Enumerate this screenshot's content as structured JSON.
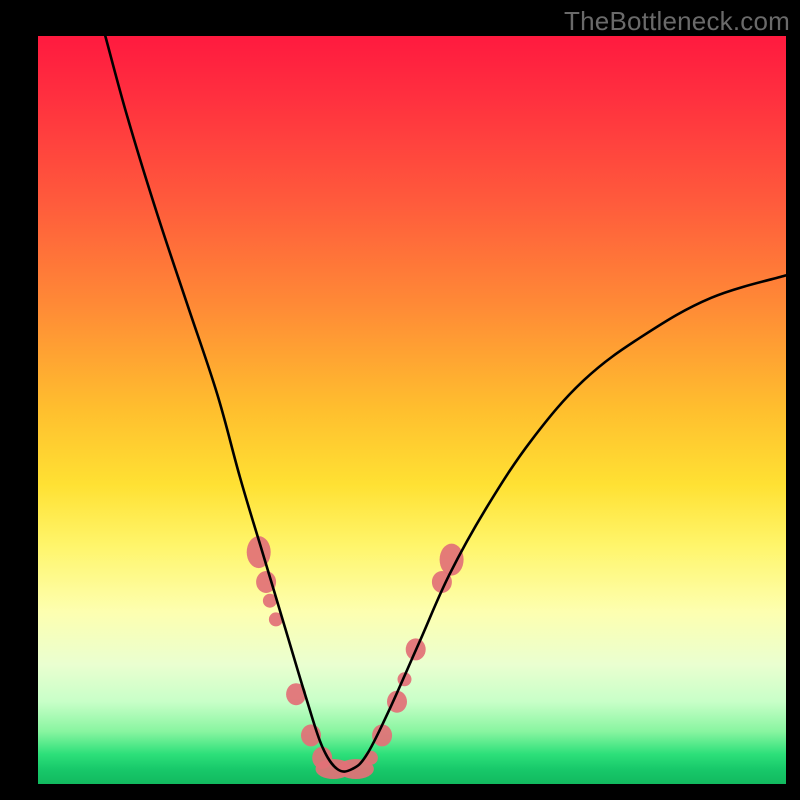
{
  "watermark": "TheBottleneck.com",
  "colors": {
    "gradient_top": "#ff1a3f",
    "gradient_mid": "#ffe133",
    "gradient_bottom": "#12b95f",
    "curve": "#000000",
    "cluster": "#e27177",
    "frame": "#000000"
  },
  "chart_data": {
    "type": "line",
    "title": "",
    "xlabel": "",
    "ylabel": "",
    "xlim": [
      0,
      100
    ],
    "ylim": [
      0,
      100
    ],
    "note": "No axes, ticks, or numeric labels are rendered. X/Y values are read as percentage positions within the gradient plot area. Y measures height above the bottom edge; 0 = bottom (green), 100 = top (red). The curve is a V-shape with a flat minimum around x≈37–44.",
    "optimum_x_range": [
      37,
      44
    ],
    "series": [
      {
        "name": "bottleneck-curve",
        "x": [
          9,
          12,
          16,
          20,
          24,
          27,
          30,
          33,
          36,
          38,
          40,
          42,
          44,
          47,
          51,
          55,
          60,
          66,
          73,
          81,
          90,
          100
        ],
        "y": [
          100,
          89,
          76,
          64,
          52,
          41,
          31,
          21,
          11,
          5,
          2,
          2,
          4,
          10,
          19,
          28,
          37,
          46,
          54,
          60,
          65,
          68
        ]
      }
    ],
    "clusters": {
      "description": "Salmon-colored highlight markers along the curve near the valley and partway up each arm.",
      "points": [
        {
          "x": 29.5,
          "y": 31,
          "shape": "pill",
          "size": "large"
        },
        {
          "x": 30.5,
          "y": 27,
          "shape": "pill",
          "size": "medium"
        },
        {
          "x": 31.0,
          "y": 24.5,
          "shape": "dot",
          "size": "small"
        },
        {
          "x": 31.8,
          "y": 22,
          "shape": "dot",
          "size": "small"
        },
        {
          "x": 34.5,
          "y": 12,
          "shape": "dot",
          "size": "medium"
        },
        {
          "x": 36.5,
          "y": 6.5,
          "shape": "pill",
          "size": "medium"
        },
        {
          "x": 38.0,
          "y": 3.5,
          "shape": "pill",
          "size": "medium"
        },
        {
          "x": 39.5,
          "y": 2.0,
          "shape": "pill",
          "size": "large-wide"
        },
        {
          "x": 42.5,
          "y": 2.0,
          "shape": "pill",
          "size": "large-wide"
        },
        {
          "x": 44.5,
          "y": 3.5,
          "shape": "dot",
          "size": "small"
        },
        {
          "x": 46.0,
          "y": 6.5,
          "shape": "pill",
          "size": "medium"
        },
        {
          "x": 48.0,
          "y": 11,
          "shape": "pill",
          "size": "medium"
        },
        {
          "x": 49.0,
          "y": 14,
          "shape": "dot",
          "size": "small"
        },
        {
          "x": 50.5,
          "y": 18,
          "shape": "pill",
          "size": "medium"
        },
        {
          "x": 54.0,
          "y": 27,
          "shape": "pill",
          "size": "medium"
        },
        {
          "x": 55.3,
          "y": 30,
          "shape": "pill",
          "size": "large"
        }
      ]
    }
  }
}
